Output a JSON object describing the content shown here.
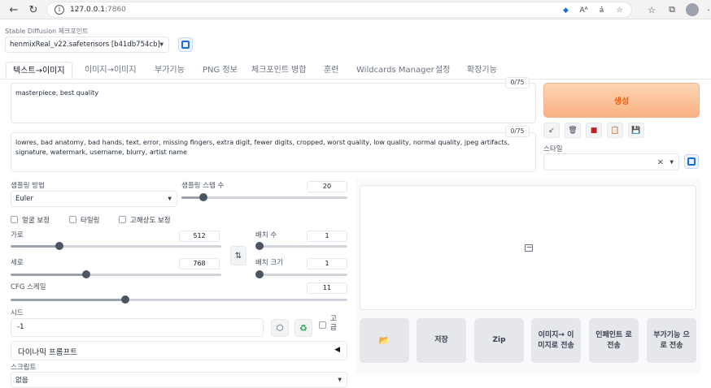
{
  "browser": {
    "url_host": "127.0.0.1",
    "url_port": ":7860",
    "reader_label": "Aᴬ",
    "translate_label": "ȧ̇"
  },
  "checkpoint": {
    "label": "Stable Diffusion 체크포인트",
    "value": "henmixReal_v22.safetensors [b41db754cb]"
  },
  "tabs": [
    {
      "label": "텍스트→이미지"
    },
    {
      "label": "이미지→이미지"
    },
    {
      "label": "부가기능"
    },
    {
      "label": "PNG 정보"
    },
    {
      "label": "체크포인트 병합"
    },
    {
      "label": "훈련"
    },
    {
      "label": "Wildcards Manager"
    },
    {
      "label": "설정"
    },
    {
      "label": "확장기능"
    }
  ],
  "prompt": {
    "positive": "masterpiece, best quality",
    "positive_count": "0/75",
    "negative": "lowres, bad anatomy, bad hands, text, error, missing fingers, extra digit, fewer digits, cropped, worst quality, low quality, normal quality, jpeg artifacts, signature, watermark, username, blurry, artist name",
    "negative_count": "0/75"
  },
  "generate_label": "생성",
  "style": {
    "label": "스타일",
    "clear": "×"
  },
  "sampling": {
    "method_label": "샘플링 방법",
    "method_value": "Euler",
    "steps_label": "샘플링 스텝 수",
    "steps_value": 20,
    "steps_fraction": 0.13
  },
  "checkboxes": [
    {
      "label": "얼굴 보정"
    },
    {
      "label": "타일링"
    },
    {
      "label": "고해상도 보정"
    }
  ],
  "width": {
    "label": "가로",
    "value": 512,
    "fraction": 0.23
  },
  "height": {
    "label": "세로",
    "value": 768,
    "fraction": 0.36
  },
  "batch_count": {
    "label": "배치 수",
    "value": 1,
    "fraction": 0.0
  },
  "batch_size": {
    "label": "배치 크기",
    "value": 1,
    "fraction": 0.0
  },
  "cfg": {
    "label": "CFG 스케일",
    "value": 11,
    "fraction": 0.34
  },
  "seed": {
    "label": "시드",
    "value": "-1",
    "extra_label_1": "고",
    "extra_label_2": "급"
  },
  "dynamic_prompt": {
    "label": "다이나믹 프롬프트"
  },
  "script": {
    "label": "스크립트",
    "value": "없음"
  },
  "actions": [
    {
      "label": "저장"
    },
    {
      "label": "Zip"
    },
    {
      "label": "이미지→ 이미지로 전송"
    },
    {
      "label": "인페인트 로 전송"
    },
    {
      "label": "부가기능 으로 전송"
    }
  ],
  "colors": {
    "accent": "#e85d0e",
    "generate_bg": "#f9b081",
    "refresh": "#1d6fd8"
  }
}
